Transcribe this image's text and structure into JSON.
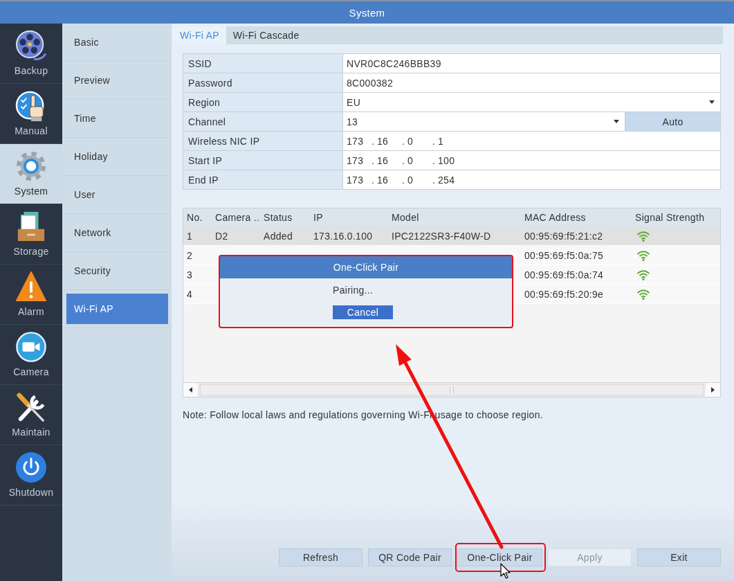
{
  "window": {
    "title": "System"
  },
  "main_menu": [
    {
      "label": "Backup",
      "selected": false
    },
    {
      "label": "Manual",
      "selected": false
    },
    {
      "label": "System",
      "selected": true
    },
    {
      "label": "Storage",
      "selected": false
    },
    {
      "label": "Alarm",
      "selected": false
    },
    {
      "label": "Camera",
      "selected": false
    },
    {
      "label": "Maintain",
      "selected": false
    },
    {
      "label": "Shutdown",
      "selected": false
    }
  ],
  "submenu": [
    {
      "label": "Basic",
      "selected": false
    },
    {
      "label": "Preview",
      "selected": false
    },
    {
      "label": "Time",
      "selected": false
    },
    {
      "label": "Holiday",
      "selected": false
    },
    {
      "label": "User",
      "selected": false
    },
    {
      "label": "Network",
      "selected": false
    },
    {
      "label": "Security",
      "selected": false
    },
    {
      "label": "Wi-Fi AP",
      "selected": true
    }
  ],
  "tabs": [
    {
      "label": "Wi-Fi AP",
      "selected": true
    },
    {
      "label": "Wi-Fi Cascade",
      "selected": false
    }
  ],
  "settings": [
    {
      "kind": "text",
      "label": "SSID",
      "value": "NVR0C8C246BBB39"
    },
    {
      "kind": "text",
      "label": "Password",
      "value": "8C000382"
    },
    {
      "kind": "select",
      "label": "Region",
      "value": "EU"
    },
    {
      "kind": "select",
      "label": "Channel",
      "value": "13",
      "button": "Auto"
    },
    {
      "kind": "ip",
      "label": "Wireless NIC IP",
      "parts": [
        "173",
        ".",
        "16",
        ".",
        "0",
        ".",
        "1"
      ]
    },
    {
      "kind": "ip",
      "label": "Start IP",
      "parts": [
        "173",
        ".",
        "16",
        ".",
        "0",
        ".",
        "100"
      ]
    },
    {
      "kind": "ip",
      "label": "End IP",
      "parts": [
        "173",
        ".",
        "16",
        ".",
        "0",
        ".",
        "254"
      ]
    }
  ],
  "devices": {
    "columns": [
      "No.",
      "Camera ..",
      "Status",
      "IP",
      "Model",
      "MAC Address",
      "Signal Strength"
    ],
    "rows": [
      {
        "no": "1",
        "camera": "D2",
        "status": "Added",
        "ip": "173.16.0.100",
        "model": "IPC2122SR3-F40W-D",
        "mac": "00:95:69:f5:21:c2",
        "selected": true
      },
      {
        "no": "2",
        "mac": "00:95:69:f5:0a:75",
        "selected": false
      },
      {
        "no": "3",
        "mac": "00:95:69:f5:0a:74",
        "selected": false
      },
      {
        "no": "4",
        "mac": "00:95:69:f5:20:9e",
        "selected": false
      }
    ]
  },
  "note": "Note: Follow local laws and regulations governing Wi-Fi usage to choose region.",
  "buttons": [
    {
      "label": "Refresh",
      "disabled": false,
      "highlighted": false
    },
    {
      "label": "QR Code Pair",
      "disabled": false,
      "highlighted": false
    },
    {
      "label": "One-Click Pair",
      "disabled": false,
      "highlighted": true
    },
    {
      "label": "Apply",
      "disabled": true,
      "highlighted": false
    },
    {
      "label": "Exit",
      "disabled": false,
      "highlighted": false
    }
  ],
  "dialog": {
    "title": "One-Click Pair",
    "message": "Pairing...",
    "button": "Cancel",
    "highlighted": true
  }
}
